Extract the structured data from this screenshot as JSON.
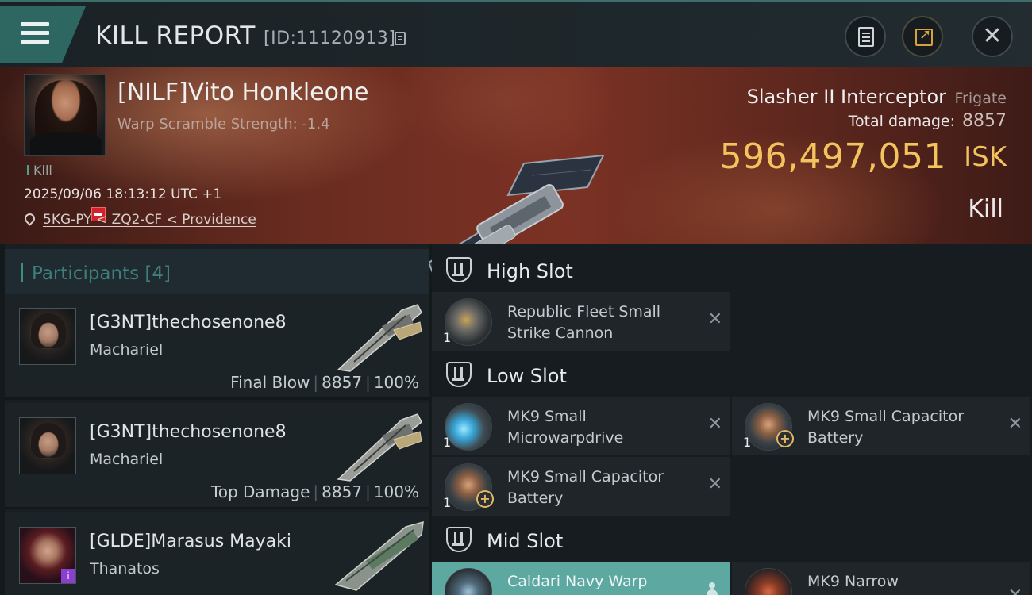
{
  "header": {
    "title": "KILL REPORT",
    "report_id": "[ID:11120913]"
  },
  "victim": {
    "name": "[NILF]Vito Honkleone",
    "warp_scramble": "Warp Scramble Strength: -1.4",
    "kill_tag": "Kill",
    "datetime": "2025/09/06 18:13:12 UTC +1",
    "location": "5KG-PY < ZQ2-CF < Providence",
    "ship_name": "Slasher II Interceptor",
    "ship_class": "Frigate",
    "total_damage_label": "Total damage:",
    "total_damage": "8857",
    "isk_value": "596,497,051",
    "isk_unit": "ISK",
    "result": "Kill"
  },
  "participants": {
    "title": "Participants",
    "count": "[4]",
    "items": [
      {
        "name": "[G3NT]thechosenone8",
        "ship": "Machariel",
        "role": "Final Blow",
        "damage": "8857",
        "percent": "100%"
      },
      {
        "name": "[G3NT]thechosenone8",
        "ship": "Machariel",
        "role": "Top Damage",
        "damage": "8857",
        "percent": "100%"
      },
      {
        "name": "[GLDE]Marasus Mayaki",
        "ship": "Thanatos"
      }
    ]
  },
  "fitting": {
    "high_slot": {
      "label": "High Slot",
      "modules": [
        {
          "qty": "1",
          "name": "Republic Fleet Small Strike Cannon"
        }
      ]
    },
    "low_slot": {
      "label": "Low Slot",
      "modules": [
        {
          "qty": "1",
          "name": "MK9 Small Microwarpdrive"
        },
        {
          "qty": "1",
          "name": "MK9 Small Capacitor Battery"
        },
        {
          "qty": "1",
          "name": "MK9 Small Capacitor Battery"
        }
      ]
    },
    "mid_slot": {
      "label": "Mid Slot",
      "modules": [
        {
          "name": "Caldari Navy Warp"
        },
        {
          "name": "MK9 Narrow"
        }
      ]
    }
  },
  "colors": {
    "accent_teal": "#2e6762",
    "isk_gold": "#f3c35e",
    "status_red": "#d3202a",
    "selected_module": "#5ea8a2"
  }
}
